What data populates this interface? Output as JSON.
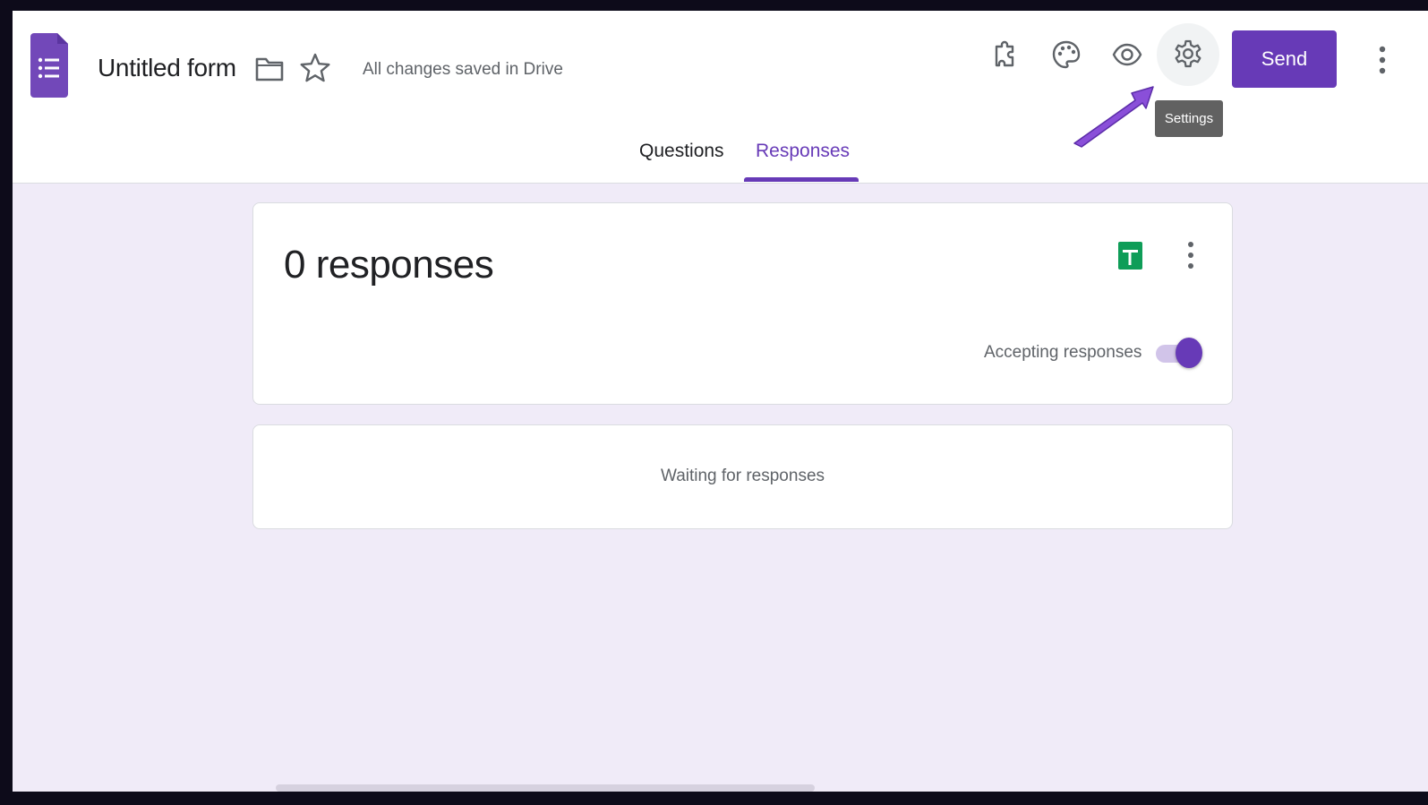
{
  "header": {
    "title": "Untitled form",
    "save_status": "All changes saved in Drive",
    "send_label": "Send",
    "tooltip": "Settings",
    "icons": [
      "forms-logo-icon",
      "folder-icon",
      "star-icon",
      "puzzle-icon",
      "palette-icon",
      "eye-icon",
      "gear-icon",
      "more-vert-icon"
    ]
  },
  "tabs": [
    {
      "label": "Questions",
      "active": false
    },
    {
      "label": "Responses",
      "active": true
    }
  ],
  "summary": {
    "count_label": "0 responses",
    "accepting_label": "Accepting responses",
    "accepting": true
  },
  "waiting": {
    "message": "Waiting for responses"
  },
  "colors": {
    "accent": "#673ab7",
    "background": "#f0ebf8",
    "sheets_green": "#0f9d58",
    "tooltip_bg": "#616161"
  }
}
